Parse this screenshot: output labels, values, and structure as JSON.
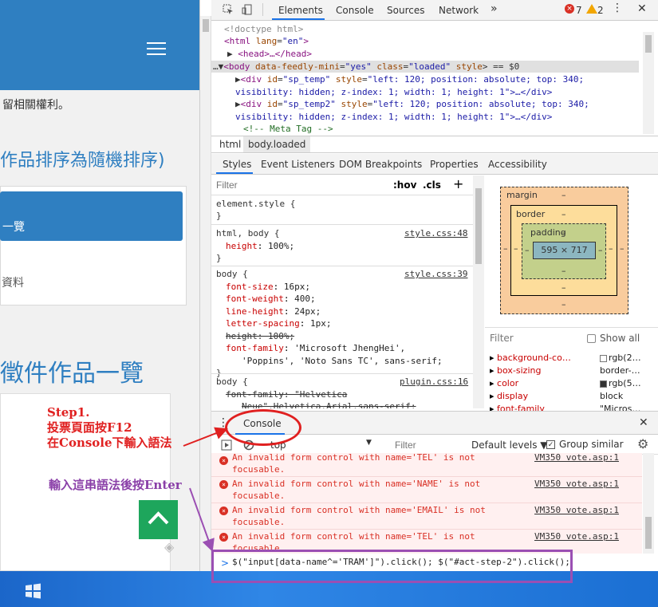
{
  "page": {
    "rights_text": "留相關權利。",
    "sort_note": "作品排序為隨機排序)",
    "panel_active": "一覽",
    "panel_item": "資料",
    "section_title": "徵件作品一覽"
  },
  "devtools": {
    "tabs": [
      "Elements",
      "Console",
      "Sources",
      "Network"
    ],
    "more_tabs": "»",
    "errors": "7",
    "warnings": "2",
    "close": "✕",
    "dom": {
      "l1": "<!doctype html>",
      "l2_tag": "<html ",
      "l2_attr": "lang",
      "l2_val": "\"en\"",
      "l3": "<head>…</head>",
      "l4_tag": "<body ",
      "l4_attr1": "data-feedly-mini",
      "l4_val1": "\"yes\"",
      "l4_attr2": "class",
      "l4_val2": "\"loaded\"",
      "l4_attr3": "style",
      "l4_suffix": "> == $0",
      "l5_tag": "<div ",
      "l5_attr1": "id",
      "l5_val1": "\"sp_temp\"",
      "l5_attr2": "style",
      "l5_val2": "\"left: 120; position: absolute; top: 340;",
      "l6": "visibility: hidden; z-index: 1; width: 1; height: 1\">…</div>",
      "l7_val1": "\"sp_temp2\"",
      "l7_val2": "\"left: 120; position: absolute; top: 340;",
      "l8": "visibility: hidden; z-index: 1; width: 1; height: 1\">…</div>",
      "l9": "<!-- Meta Tag -->"
    },
    "breadcrumbs": [
      "html",
      "body.loaded"
    ],
    "subtabs": [
      "Styles",
      "Event Listeners",
      "DOM Breakpoints",
      "Properties",
      "Accessibility"
    ],
    "styles_filter_placeholder": "Filter",
    "hov": ":hov",
    "cls": ".cls",
    "plus": "+",
    "styles": {
      "r1": "element.style {",
      "r1_close": "}",
      "r2_sel": "html, body {",
      "r2_src": "style.css:48",
      "r2_p1": "height",
      "r2_v1": "100%;",
      "r2_close": "}",
      "r3_sel": "body {",
      "r3_src": "style.css:39",
      "r3_p1": "font-size",
      "r3_v1": "16px;",
      "r3_p2": "font-weight",
      "r3_v2": "400;",
      "r3_p3": "line-height",
      "r3_v3": "24px;",
      "r3_p4": "letter-spacing",
      "r3_v4": "1px;",
      "r3_p5": "height: 100%;",
      "r3_p6": "font-family",
      "r3_v6": "'Microsoft JhengHei',",
      "r3_v6b": "'Poppins', 'Noto Sans TC', sans-serif;",
      "r3_close": "}",
      "r4_sel": "body {",
      "r4_src": "plugin.css:16",
      "r4_p1": "font-family: \"Helvetica",
      "r4_p1b": "Neue\",Helvetica,Arial,sans-serif;"
    },
    "boxmodel": {
      "margin": "margin",
      "border": "border",
      "padding": "padding",
      "content": "595 × 717",
      "dash": "–"
    },
    "computed_filter": "Filter",
    "show_all": "Show all",
    "computed": [
      {
        "prop": "background-co…",
        "val": "rgb(2…",
        "swatch": "#ffffff"
      },
      {
        "prop": "box-sizing",
        "val": "border-…",
        "swatch": ""
      },
      {
        "prop": "color",
        "val": "rgb(5…",
        "swatch": "#333333"
      },
      {
        "prop": "display",
        "val": "block",
        "swatch": ""
      },
      {
        "prop": "font-family",
        "val": "\"Micros…",
        "swatch": ""
      }
    ],
    "drawer_tab": "Console",
    "context": "top",
    "console_filter_placeholder": "Filter",
    "default_levels": "Default levels ▼",
    "group_similar": "Group similar",
    "messages": [
      {
        "text": "An invalid form control with name='TEL' is not\nfocusable.",
        "src": "VM350 vote.asp:1"
      },
      {
        "text": "An invalid form control with name='NAME' is not\nfocusable.",
        "src": "VM350 vote.asp:1"
      },
      {
        "text": "An invalid form control with name='EMAIL' is not\nfocusable.",
        "src": "VM350 vote.asp:1"
      },
      {
        "text": "An invalid form control with name='TEL' is not\nfocusable.",
        "src": "VM350 vote.asp:1"
      }
    ],
    "prompt": ">",
    "console_input": "$(\"input[data-name^='TRAM']\").click(); $(\"#act-step-2\").click();"
  },
  "annotations": {
    "step_line1": "Step1.",
    "step_line2": "投票頁面按F12",
    "step_line3": "在Console下輸入語法",
    "enter_note": "輸入這串語法後按Enter"
  },
  "colors": {
    "accent_blue": "#2f7fc1",
    "annotation_red": "#e02020",
    "annotation_purple": "#9b4fb3",
    "go_top_green": "#1ea65c"
  }
}
